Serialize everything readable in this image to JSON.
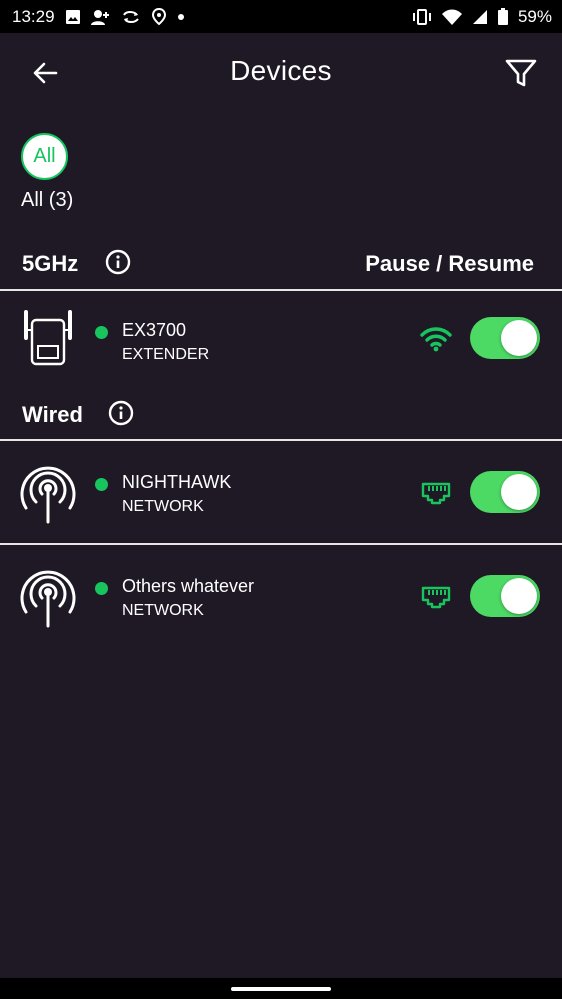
{
  "status_bar": {
    "time": "13:29",
    "battery": "59%",
    "left_icons": [
      "image-icon",
      "person-add-icon",
      "sync-icon",
      "location-icon",
      "dot-icon"
    ],
    "right_icons": [
      "vibrate-icon",
      "wifi-icon",
      "signal-icon",
      "battery-icon"
    ]
  },
  "header": {
    "title": "Devices",
    "back_icon": "back-arrow-icon",
    "filter_icon": "filter-icon"
  },
  "filter_chip": {
    "label": "All",
    "count_label": "All (3)"
  },
  "pause_resume_label": "Pause / Resume",
  "colors": {
    "background": "#1f1925",
    "accent_green": "#17c45e",
    "toggle_on": "#4cd964"
  },
  "sections": [
    {
      "title": "5GHz",
      "devices": [
        {
          "name": "EX3700",
          "type": "EXTENDER",
          "icon": "extender-icon",
          "connection": "wifi-icon",
          "online": true,
          "enabled": true
        }
      ]
    },
    {
      "title": "Wired",
      "devices": [
        {
          "name": "NIGHTHAWK",
          "type": "NETWORK",
          "icon": "antenna-icon",
          "connection": "ethernet-icon",
          "online": true,
          "enabled": true
        },
        {
          "name": "Others whatever",
          "type": "NETWORK",
          "icon": "antenna-icon",
          "connection": "ethernet-icon",
          "online": true,
          "enabled": true
        }
      ]
    }
  ]
}
